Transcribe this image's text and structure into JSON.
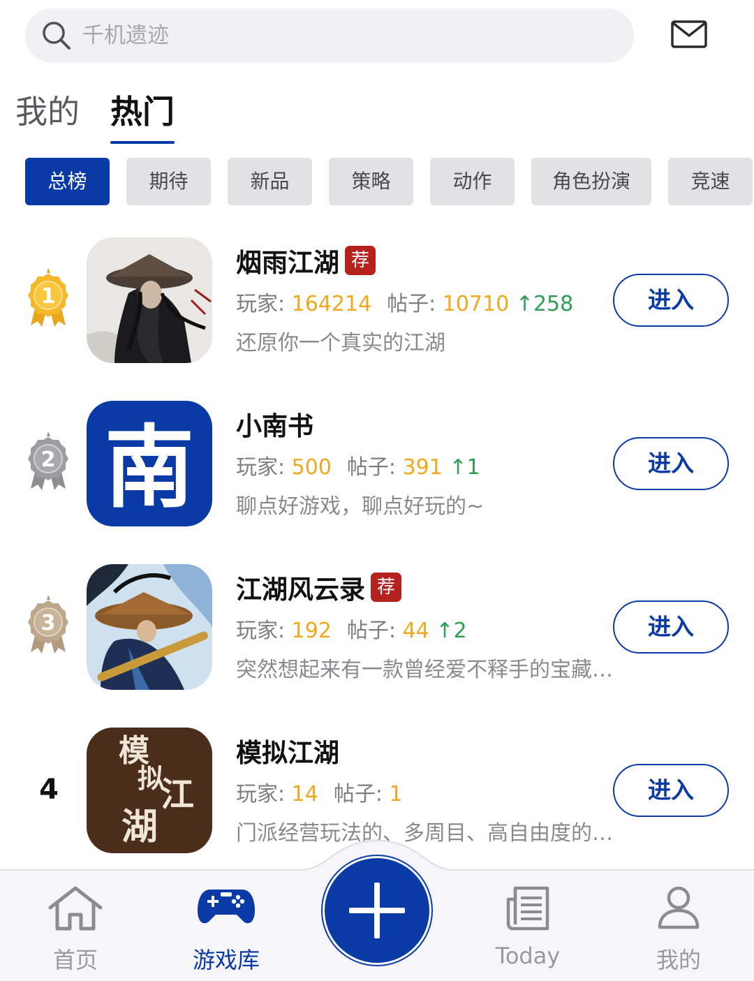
{
  "search": {
    "placeholder": "千机遗迹"
  },
  "tabs": [
    {
      "label": "我的",
      "active": false
    },
    {
      "label": "热门",
      "active": true
    }
  ],
  "categories": [
    "总榜",
    "期待",
    "新品",
    "策略",
    "动作",
    "角色扮演",
    "竞速"
  ],
  "active_category": "总榜",
  "labels": {
    "players": "玩家: ",
    "posts": "帖子: ",
    "enter": "进入",
    "recommend": "荐"
  },
  "games": [
    {
      "rank": "1",
      "title": "烟雨江湖",
      "recommended": true,
      "players": "164214",
      "posts": "10710",
      "trend": "↑258",
      "desc": "还原你一个真实的江湖",
      "medal": "gold"
    },
    {
      "rank": "2",
      "title": "小南书",
      "recommended": false,
      "players": "500",
      "posts": "391",
      "trend": "↑1",
      "desc": "聊点好游戏，聊点好玩的~",
      "medal": "silver"
    },
    {
      "rank": "3",
      "title": "江湖风云录",
      "recommended": true,
      "players": "192",
      "posts": "44",
      "trend": "↑2",
      "desc": "突然想起来有一款曾经爱不释手的宝藏游戏",
      "medal": "bronze"
    },
    {
      "rank": "4",
      "title": "模拟江湖",
      "recommended": false,
      "players": "14",
      "posts": "1",
      "trend": "",
      "desc": "门派经营玩法的、多周目、高自由度的武侠游戏",
      "medal": ""
    }
  ],
  "icon_art": {
    "game2_char": "南",
    "game4_chars": [
      "模",
      "拟",
      "江",
      "湖"
    ]
  },
  "nav": [
    {
      "label": "首页",
      "icon": "home-icon",
      "active": false
    },
    {
      "label": "游戏库",
      "icon": "gamepad-icon",
      "active": true
    },
    {
      "label": "Today",
      "icon": "news-icon",
      "active": false
    },
    {
      "label": "我的",
      "icon": "user-icon",
      "active": false
    }
  ],
  "colors": {
    "accent": "#0a3aa6",
    "stat_number": "#f0a81c",
    "trend": "#2e9f52",
    "badge": "#b5211c"
  }
}
